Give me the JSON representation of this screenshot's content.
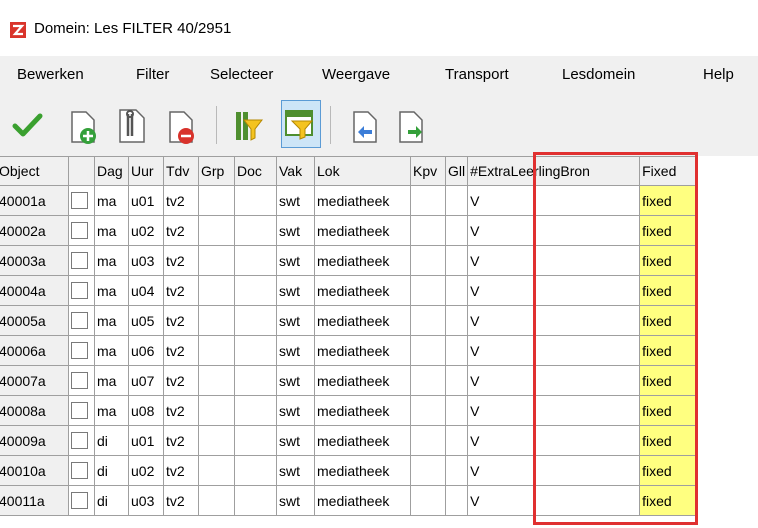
{
  "window": {
    "title": "Domein: Les FILTER  40/2951"
  },
  "menu": [
    "Bewerken",
    "Filter",
    "Selecteer",
    "Weergave",
    "Transport",
    "Lesdomein",
    "Help"
  ],
  "toolbar": {
    "icons": [
      "checkmark-icon",
      "add-document-icon",
      "tools-document-icon",
      "remove-document-icon",
      "filter-icon",
      "table-filter-icon",
      "arrow-left-document-icon",
      "arrow-right-document-icon"
    ]
  },
  "table": {
    "columns": [
      "Object",
      "",
      "Dag",
      "Uur",
      "Tdv",
      "Grp",
      "Doc",
      "Vak",
      "Lok",
      "Kpv",
      "Gll",
      "#ExtraLeerlingBron",
      "Fixed"
    ],
    "rows": [
      {
        "object": "40001a",
        "dag": "ma",
        "uur": "u01",
        "tdv": "tv2",
        "grp": "",
        "doc": "",
        "vak": "swt",
        "lok": "mediatheek",
        "kpv": "",
        "gll": "",
        "extra": "V",
        "fixed": "fixed"
      },
      {
        "object": "40002a",
        "dag": "ma",
        "uur": "u02",
        "tdv": "tv2",
        "grp": "",
        "doc": "",
        "vak": "swt",
        "lok": "mediatheek",
        "kpv": "",
        "gll": "",
        "extra": "V",
        "fixed": "fixed"
      },
      {
        "object": "40003a",
        "dag": "ma",
        "uur": "u03",
        "tdv": "tv2",
        "grp": "",
        "doc": "",
        "vak": "swt",
        "lok": "mediatheek",
        "kpv": "",
        "gll": "",
        "extra": "V",
        "fixed": "fixed"
      },
      {
        "object": "40004a",
        "dag": "ma",
        "uur": "u04",
        "tdv": "tv2",
        "grp": "",
        "doc": "",
        "vak": "swt",
        "lok": "mediatheek",
        "kpv": "",
        "gll": "",
        "extra": "V",
        "fixed": "fixed"
      },
      {
        "object": "40005a",
        "dag": "ma",
        "uur": "u05",
        "tdv": "tv2",
        "grp": "",
        "doc": "",
        "vak": "swt",
        "lok": "mediatheek",
        "kpv": "",
        "gll": "",
        "extra": "V",
        "fixed": "fixed"
      },
      {
        "object": "40006a",
        "dag": "ma",
        "uur": "u06",
        "tdv": "tv2",
        "grp": "",
        "doc": "",
        "vak": "swt",
        "lok": "mediatheek",
        "kpv": "",
        "gll": "",
        "extra": "V",
        "fixed": "fixed"
      },
      {
        "object": "40007a",
        "dag": "ma",
        "uur": "u07",
        "tdv": "tv2",
        "grp": "",
        "doc": "",
        "vak": "swt",
        "lok": "mediatheek",
        "kpv": "",
        "gll": "",
        "extra": "V",
        "fixed": "fixed"
      },
      {
        "object": "40008a",
        "dag": "ma",
        "uur": "u08",
        "tdv": "tv2",
        "grp": "",
        "doc": "",
        "vak": "swt",
        "lok": "mediatheek",
        "kpv": "",
        "gll": "",
        "extra": "V",
        "fixed": "fixed"
      },
      {
        "object": "40009a",
        "dag": "di",
        "uur": "u01",
        "tdv": "tv2",
        "grp": "",
        "doc": "",
        "vak": "swt",
        "lok": "mediatheek",
        "kpv": "",
        "gll": "",
        "extra": "V",
        "fixed": "fixed"
      },
      {
        "object": "40010a",
        "dag": "di",
        "uur": "u02",
        "tdv": "tv2",
        "grp": "",
        "doc": "",
        "vak": "swt",
        "lok": "mediatheek",
        "kpv": "",
        "gll": "",
        "extra": "V",
        "fixed": "fixed"
      },
      {
        "object": "40011a",
        "dag": "di",
        "uur": "u03",
        "tdv": "tv2",
        "grp": "",
        "doc": "",
        "vak": "swt",
        "lok": "mediatheek",
        "kpv": "",
        "gll": "",
        "extra": "V",
        "fixed": "fixed"
      }
    ]
  },
  "colors": {
    "fixed_bg": "#ffff80",
    "highlight": "#e03030",
    "chrome": "#f0f0f0"
  }
}
